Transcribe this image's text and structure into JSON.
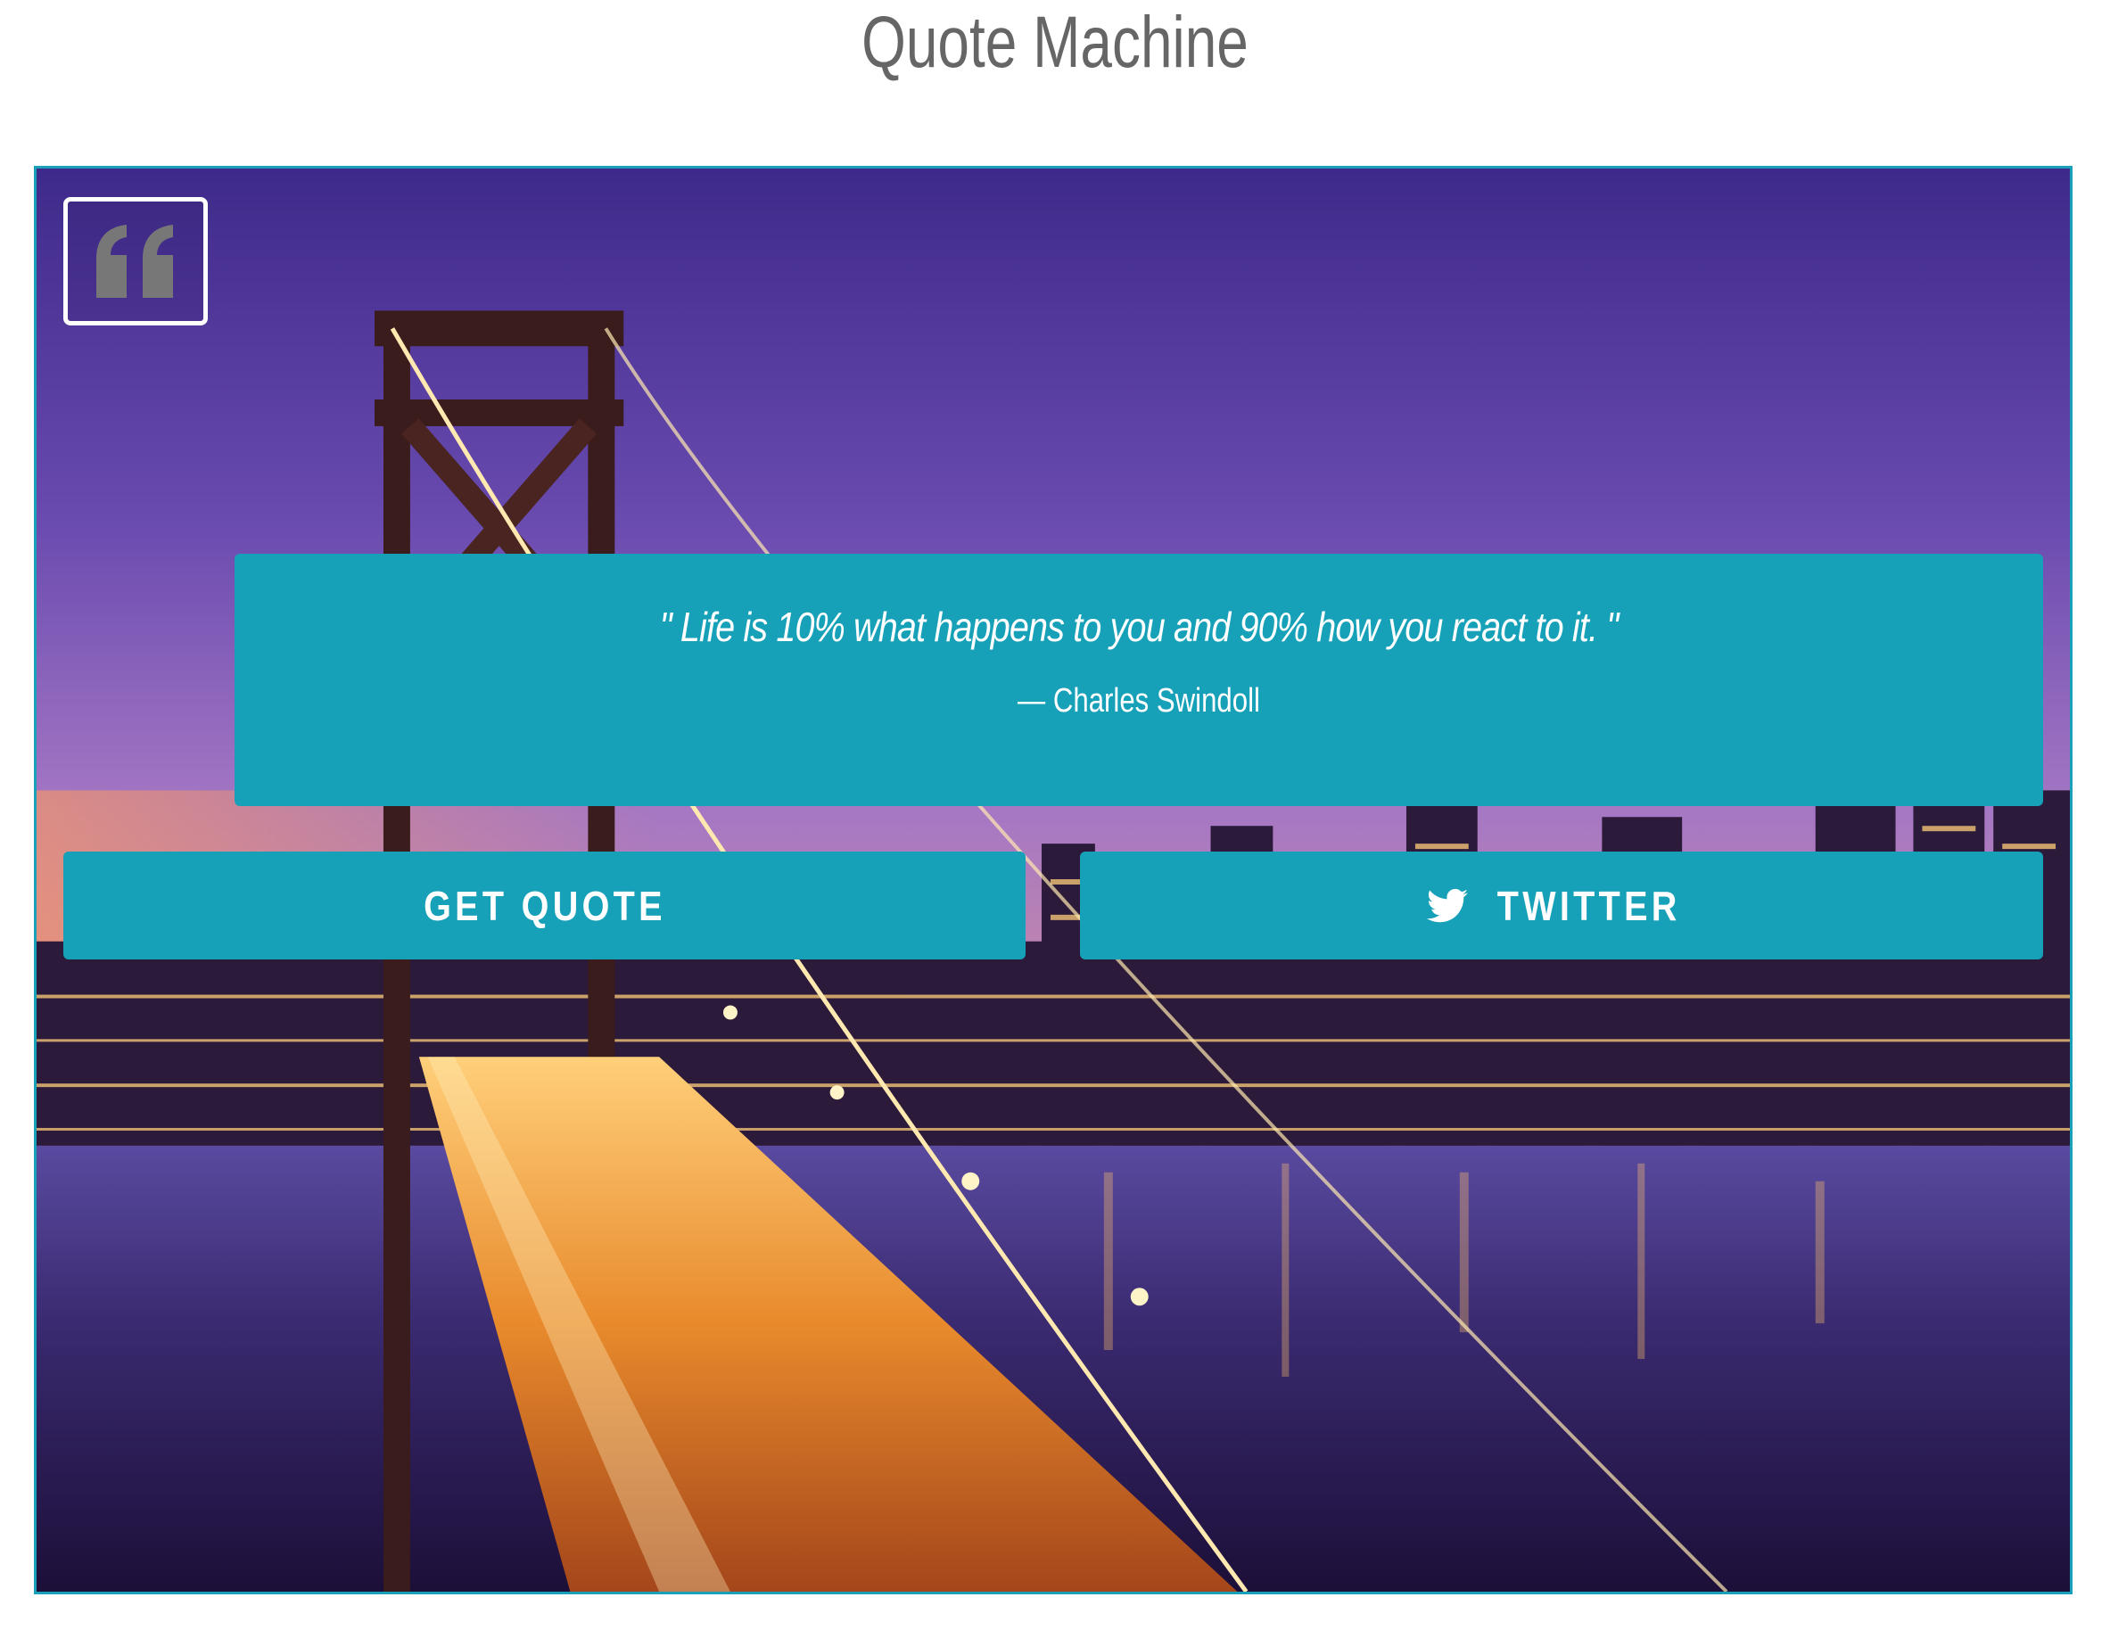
{
  "header": {
    "title": "Quote Machine"
  },
  "quote": {
    "text": "\" Life is 10% what happens to you and 90% how you react to it. \"",
    "author": "— Charles Swindoll"
  },
  "buttons": {
    "get_quote_label": "GET QUOTE",
    "twitter_label": "TWITTER"
  },
  "icons": {
    "quote_icon": "quote-left-icon",
    "twitter_icon": "twitter-bird-icon"
  },
  "colors": {
    "accent": "#17a1b9",
    "title": "#666666",
    "icon_fill": "#777777"
  }
}
